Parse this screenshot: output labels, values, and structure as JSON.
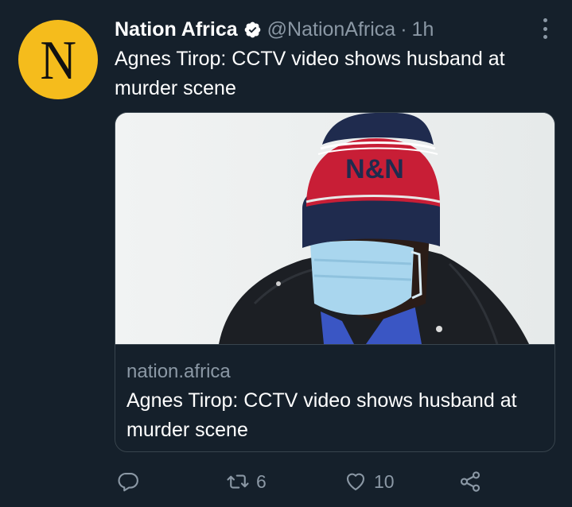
{
  "author": {
    "name": "Nation Africa",
    "handle": "@NationAfrica",
    "separator": "·",
    "time": "1h",
    "avatar_letter": "N",
    "avatar_color": "#f5bc1c",
    "verified": true
  },
  "tweet": {
    "text": "Agnes Tirop: CCTV video shows husband at murder scene"
  },
  "card": {
    "domain": "nation.africa",
    "title": "Agnes Tirop: CCTV video shows husband at murder scene",
    "image_hat_text": "N&N"
  },
  "actions": {
    "reply_icon": "reply-bubble-icon",
    "retweet_count": "6",
    "like_count": "10",
    "share_icon": "share-icon"
  },
  "colors": {
    "background": "#15202b",
    "text_primary": "#ffffff",
    "text_secondary": "#8b98a5",
    "border": "#38444d",
    "verified": "#ffffff"
  }
}
